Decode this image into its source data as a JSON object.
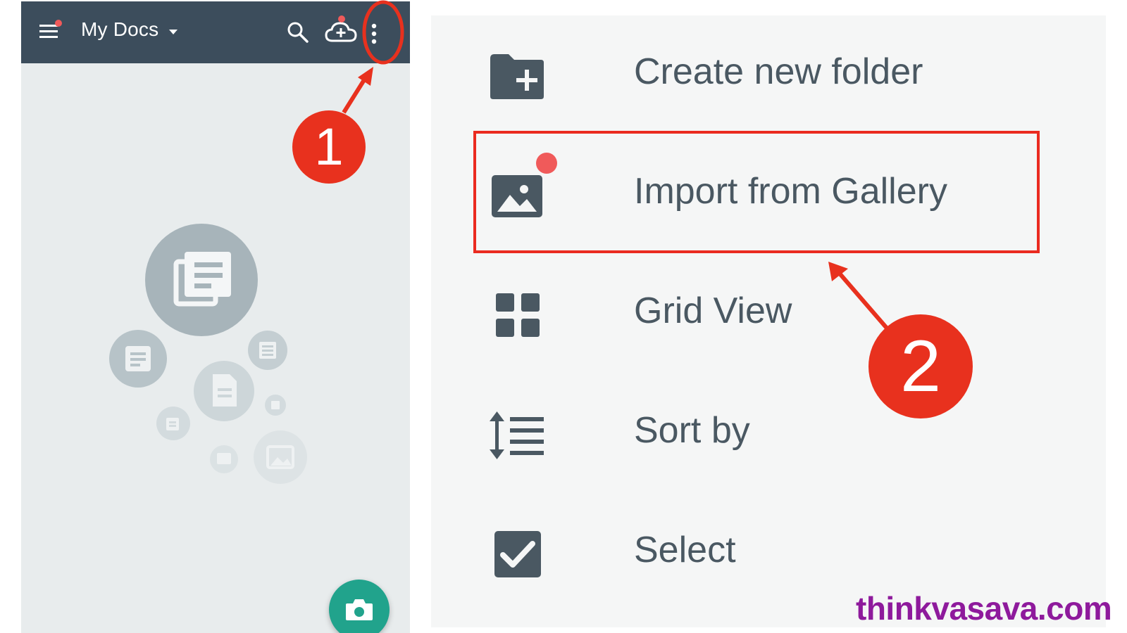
{
  "app_bar": {
    "title": "My Docs",
    "icons": [
      "menu-icon",
      "search-icon",
      "cloud-upload-icon",
      "more-vert-icon"
    ],
    "background": "#3c4d5c"
  },
  "empty_state": {
    "icons": [
      "documents-icon",
      "document-text-icon",
      "file-icon",
      "image-icon"
    ]
  },
  "fab": {
    "icon": "camera-icon",
    "color": "#21a38c"
  },
  "menu": {
    "items": [
      {
        "label": "Create new folder",
        "icon": "folder-add-icon"
      },
      {
        "label": "Import from Gallery",
        "icon": "image-icon"
      },
      {
        "label": "Grid View",
        "icon": "grid-icon"
      },
      {
        "label": "Sort by",
        "icon": "sort-icon"
      },
      {
        "label": "Select",
        "icon": "checkbox-icon"
      }
    ]
  },
  "annotations": {
    "step1": "1",
    "step2": "2",
    "color": "#e8311e"
  },
  "watermark": "thinkvasava.com"
}
